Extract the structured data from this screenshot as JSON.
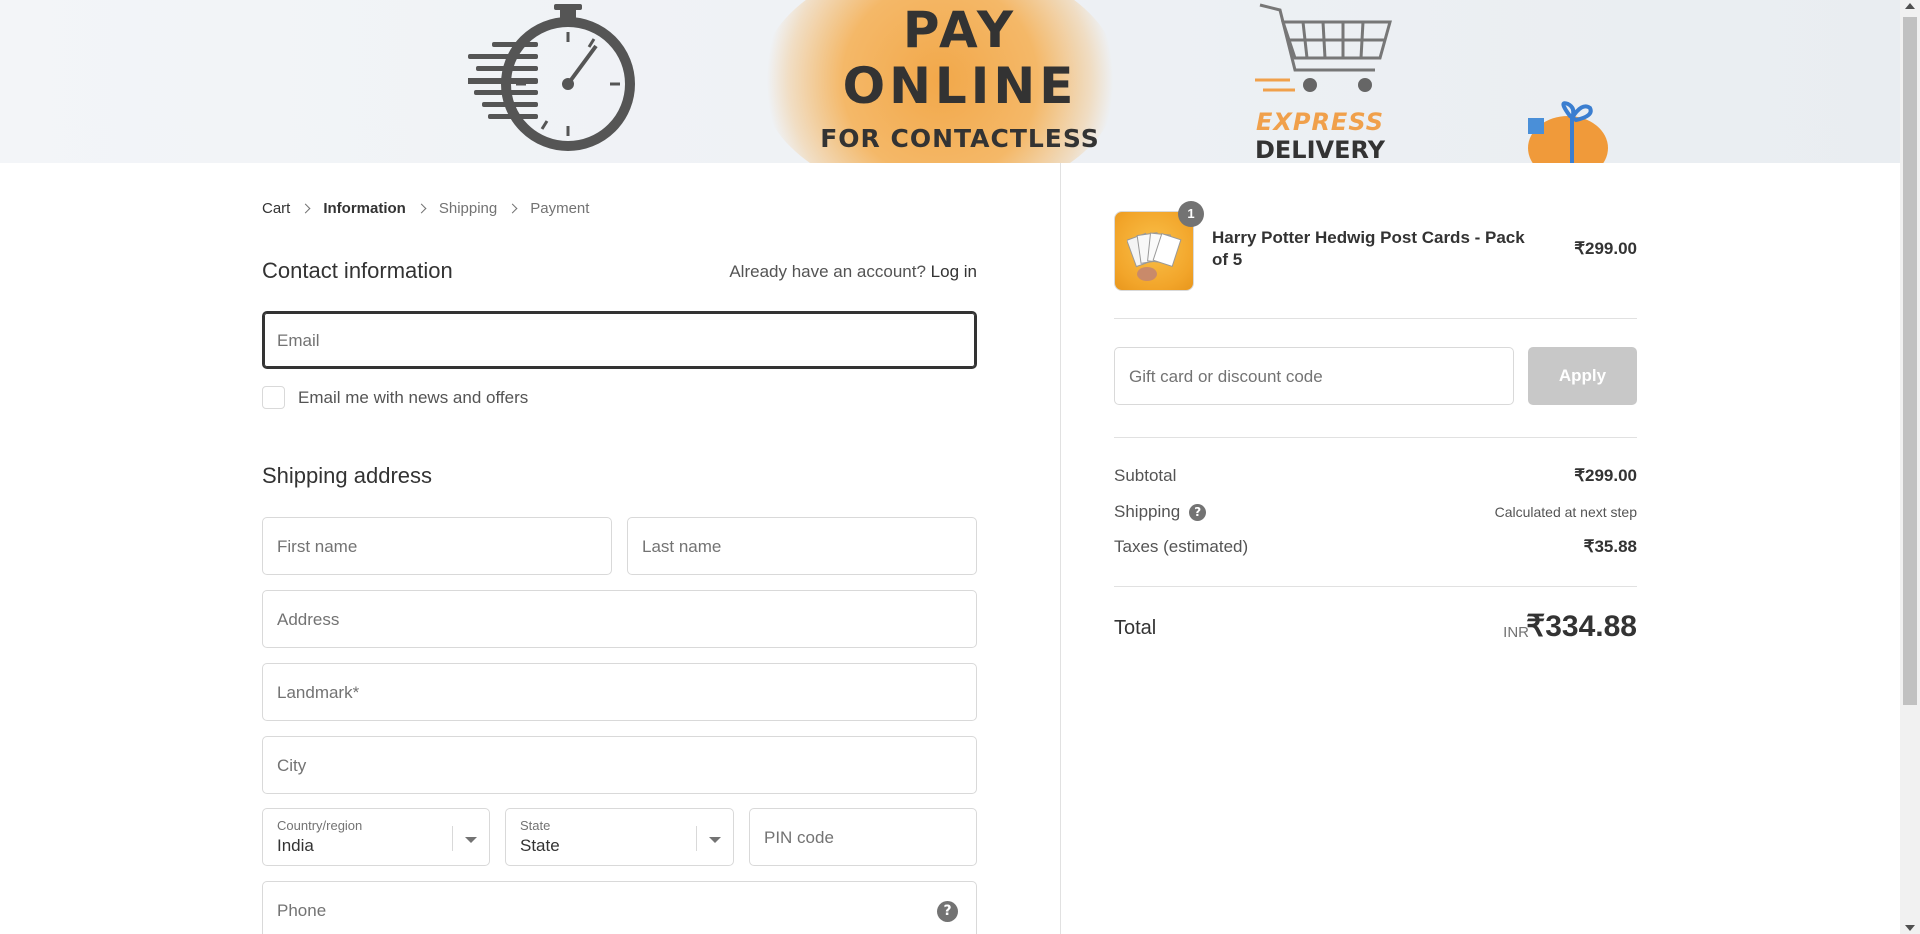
{
  "banner": {
    "line1": "PAY",
    "line2": "ONLINE",
    "line3": "FOR CONTACTLESS DELIVERY",
    "express_word1": "EXPRESS",
    "express_word2": "DELIVERY",
    "colors": {
      "accent": "#f0a04b",
      "text": "#333333"
    }
  },
  "breadcrumb": {
    "items": [
      {
        "label": "Cart",
        "state": "link"
      },
      {
        "label": "Information",
        "state": "current"
      },
      {
        "label": "Shipping",
        "state": "upcoming"
      },
      {
        "label": "Payment",
        "state": "upcoming"
      }
    ]
  },
  "contact": {
    "title": "Contact information",
    "account_prompt": "Already have an account?",
    "login_label": "Log in",
    "email_placeholder": "Email",
    "newsletter_label": "Email me with news and offers"
  },
  "shipping": {
    "title": "Shipping address",
    "first_name_placeholder": "First name",
    "last_name_placeholder": "Last name",
    "address_placeholder": "Address",
    "landmark_placeholder": "Landmark*",
    "city_placeholder": "City",
    "country_label": "Country/region",
    "country_value": "India",
    "state_label": "State",
    "state_value": "State",
    "pin_placeholder": "PIN code",
    "phone_placeholder": "Phone"
  },
  "order": {
    "item": {
      "name": "Harry Potter Hedwig Post Cards - Pack of 5",
      "price": "₹299.00",
      "quantity": "1"
    },
    "discount_placeholder": "Gift card or discount code",
    "apply_label": "Apply",
    "subtotal_label": "Subtotal",
    "subtotal_value": "₹299.00",
    "shipping_label": "Shipping",
    "shipping_value": "Calculated at next step",
    "taxes_label": "Taxes (estimated)",
    "taxes_value": "₹35.88",
    "total_label": "Total",
    "total_currency": "INR",
    "total_value": "₹334.88"
  }
}
